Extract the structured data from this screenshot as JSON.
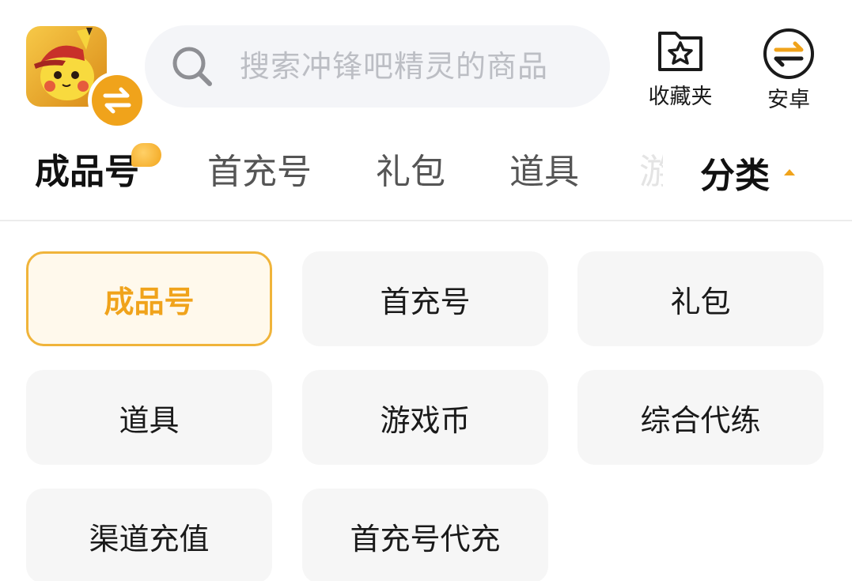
{
  "header": {
    "search_placeholder": "搜索冲锋吧精灵的商品",
    "favorites_label": "收藏夹",
    "platform_label": "安卓"
  },
  "tabs": [
    {
      "label": "成品号",
      "active": true
    },
    {
      "label": "首充号",
      "active": false
    },
    {
      "label": "礼包",
      "active": false
    },
    {
      "label": "道具",
      "active": false
    }
  ],
  "category_toggle": {
    "label": "分类"
  },
  "categories": [
    {
      "label": "成品号",
      "selected": true
    },
    {
      "label": "首充号",
      "selected": false
    },
    {
      "label": "礼包",
      "selected": false
    },
    {
      "label": "道具",
      "selected": false
    },
    {
      "label": "游戏币",
      "selected": false
    },
    {
      "label": "综合代练",
      "selected": false
    },
    {
      "label": "渠道充值",
      "selected": false
    },
    {
      "label": "首充号代充",
      "selected": false
    }
  ],
  "colors": {
    "accent": "#f0a31b",
    "selected_bg": "#fff9ec",
    "cell_bg": "#f6f6f6",
    "search_bg": "#f4f5f8"
  }
}
